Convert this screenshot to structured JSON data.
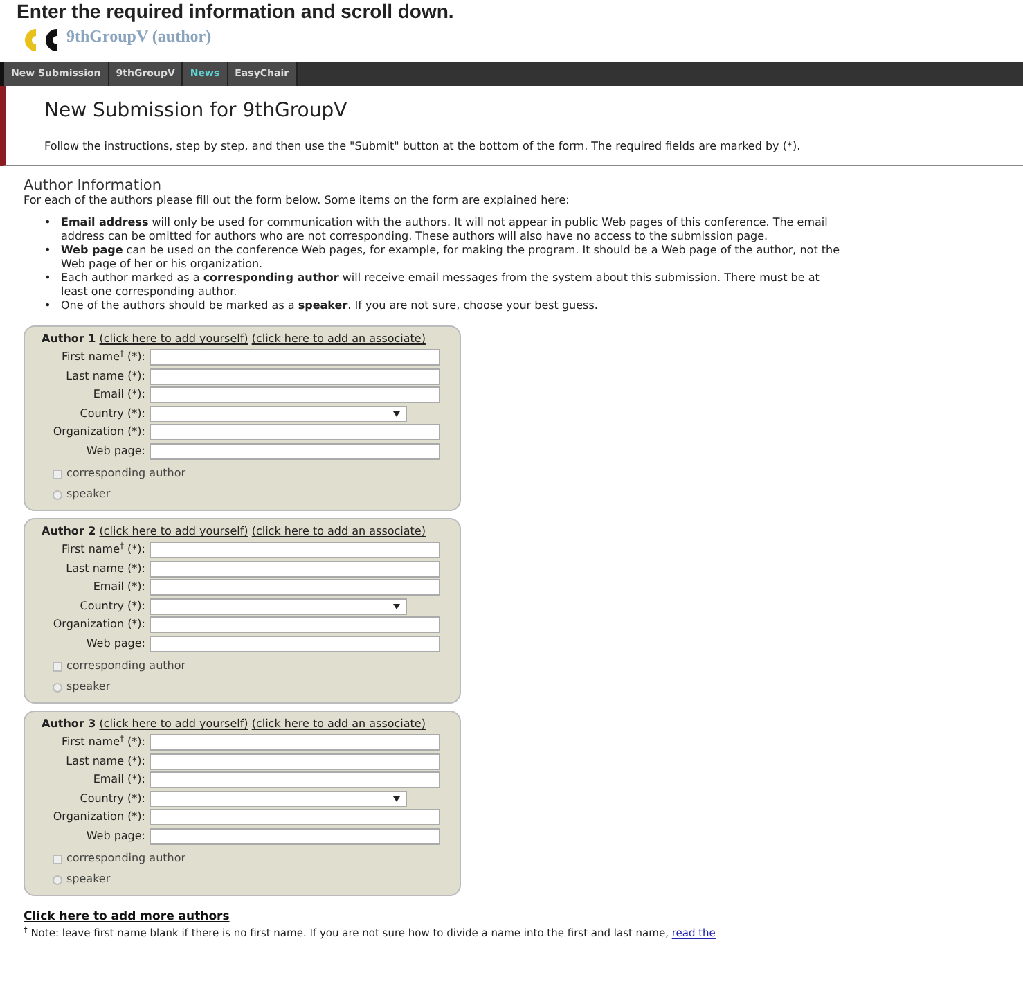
{
  "caption": "Enter the required information and scroll down.",
  "header": {
    "title": "9thGroupV (author)"
  },
  "nav": [
    {
      "label": "New Submission",
      "selected": false
    },
    {
      "label": "9thGroupV",
      "selected": false
    },
    {
      "label": "News",
      "selected": true
    },
    {
      "label": "EasyChair",
      "selected": false
    }
  ],
  "page_title": "New Submission for 9thGroupV",
  "instructions": "Follow the instructions, step by step, and then use the \"Submit\" button at the bottom of the form. The required fields are marked by (*).",
  "section": {
    "title": "Author Information",
    "intro": "For each of the authors please fill out the form below. Some items on the form are explained here:",
    "bullets": [
      {
        "marker": "•",
        "text": "**Email address** will only be used for communication with the authors. It will not appear in public Web pages of this conference. The email address can be omitted for authors who are not corresponding. These authors will also have no access to the submission page."
      },
      {
        "marker": "•",
        "text": "**Web page** can be used on the conference Web pages, for example, for making the program. It should be a Web page of the author, not the Web page of her or his organization."
      },
      {
        "marker": "•",
        "text": "Each author marked as a **corresponding author** will receive email messages from the system about this submission. There must be at least one corresponding author."
      },
      {
        "marker": "•",
        "text": "One of the authors should be marked as a **speaker**. If you are not sure, choose your best guess."
      }
    ]
  },
  "authors": [
    {
      "title": "Author 1",
      "links": [
        "(click here to add yourself)",
        "(click here to add an associate)"
      ],
      "fields": [
        {
          "label": "First name$^{†}$ (*):",
          "kind": "text"
        },
        {
          "label": "Last name (*):",
          "kind": "text"
        },
        {
          "label": "Email (*):",
          "kind": "text"
        },
        {
          "label": "Country (*):",
          "kind": "select"
        },
        {
          "label": "Organization (*):",
          "kind": "text"
        },
        {
          "label": "Web page:",
          "kind": "text"
        }
      ],
      "corresponding": {
        "label": "corresponding author",
        "checked": false
      },
      "speaker": {
        "label": "speaker",
        "selected": false
      }
    },
    {
      "title": "Author 2",
      "links": [
        "(click here to add yourself)",
        "(click here to add an associate)"
      ],
      "fields": [
        {
          "label": "First name$^{†}$ (*):",
          "kind": "text"
        },
        {
          "label": "Last name (*):",
          "kind": "text"
        },
        {
          "label": "Email (*):",
          "kind": "text"
        },
        {
          "label": "Country (*):",
          "kind": "select"
        },
        {
          "label": "Organization (*):",
          "kind": "text"
        },
        {
          "label": "Web page:",
          "kind": "text"
        }
      ],
      "corresponding": {
        "label": "corresponding author",
        "checked": false
      },
      "speaker": {
        "label": "speaker",
        "selected": false
      }
    },
    {
      "title": "Author 3",
      "links": [
        "(click here to add yourself)",
        "(click here to add an associate)"
      ],
      "fields": [
        {
          "label": "First name$^{†}$ (*):",
          "kind": "text"
        },
        {
          "label": "Last name (*):",
          "kind": "text"
        },
        {
          "label": "Email (*):",
          "kind": "text"
        },
        {
          "label": "Country (*):",
          "kind": "select"
        },
        {
          "label": "Organization (*):",
          "kind": "text"
        },
        {
          "label": "Web page:",
          "kind": "text"
        }
      ],
      "corresponding": {
        "label": "corresponding author",
        "checked": false
      },
      "speaker": {
        "label": "speaker",
        "selected": false
      }
    }
  ],
  "add_more": "Click here to add more authors",
  "note": {
    "text": "$^{†}$ Note: leave first name blank if there is no first name. If you are not sure how to divide a name into the first and last name,",
    "link": "read the"
  }
}
